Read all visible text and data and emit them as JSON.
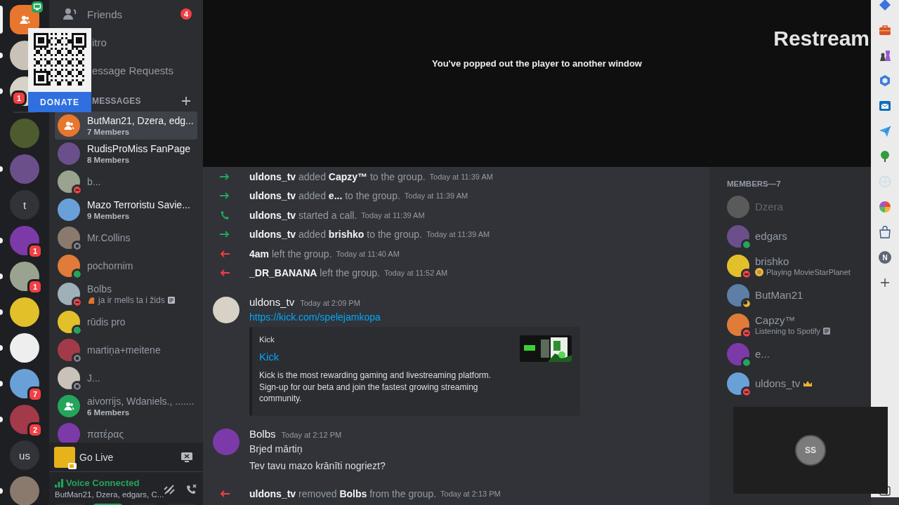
{
  "servers": [
    {
      "kind": "home",
      "selected": true
    },
    {
      "kind": "covered_avatar",
      "selected": false,
      "unread": true
    },
    {
      "kind": "covered_avatar",
      "selected": false,
      "unread": true,
      "badge": "1"
    },
    {
      "kind": "divider"
    },
    {
      "kind": "avatar",
      "selected": false,
      "unread": false
    },
    {
      "kind": "avatar",
      "selected": false,
      "unread": true
    },
    {
      "kind": "text",
      "label": "t",
      "selected": false,
      "unread": false
    },
    {
      "kind": "avatar",
      "selected": false,
      "unread": true,
      "badge": "1"
    },
    {
      "kind": "avatar",
      "selected": false,
      "unread": true,
      "badge": "1"
    },
    {
      "kind": "avatar",
      "selected": false,
      "unread": true
    },
    {
      "kind": "avatar",
      "selected": false,
      "unread": true
    },
    {
      "kind": "avatar",
      "selected": false,
      "unread": true,
      "badge": "7"
    },
    {
      "kind": "avatar",
      "selected": false,
      "unread": true,
      "badge": "2"
    },
    {
      "kind": "text",
      "label": "us",
      "selected": false,
      "unread": false
    },
    {
      "kind": "avatar",
      "selected": false,
      "unread": true
    }
  ],
  "donate": {
    "label": "DONATE"
  },
  "dm_nav": [
    {
      "kind": "friends",
      "label": "Friends",
      "badge": "4"
    },
    {
      "kind": "covered",
      "label": "itro"
    },
    {
      "kind": "covered",
      "label": "essage Requests"
    }
  ],
  "dm_header": {
    "label": "MESSAGES"
  },
  "dms": [
    {
      "kind": "group",
      "name": "ButMan21, Dzera, edg...",
      "subtitle": "7 Members",
      "color": "#e8762d",
      "selected": true,
      "unread": true
    },
    {
      "kind": "user",
      "name": "RudisProMiss FanPage",
      "subtitle": "8 Members",
      "selected": false,
      "unread": true
    },
    {
      "kind": "user",
      "name": "b...",
      "status": {
        "kind": "dnd"
      },
      "selected": false,
      "unread": false
    },
    {
      "kind": "user",
      "name": "Mazo Terroristu Savie...",
      "subtitle": "9 Members",
      "selected": false,
      "unread": true
    },
    {
      "kind": "user",
      "name": "Mr.Collins",
      "status": {
        "kind": "offline"
      },
      "selected": false,
      "unread": false
    },
    {
      "kind": "user",
      "name": "pochornim",
      "status": {
        "kind": "online"
      },
      "selected": false,
      "unread": false
    },
    {
      "kind": "user",
      "name": "Bolbs",
      "status": {
        "kind": "dnd"
      },
      "activity": "ja ir mells ta i žids",
      "selected": false,
      "unread": false
    },
    {
      "kind": "user",
      "name": "rūdis pro",
      "status": {
        "kind": "online"
      },
      "selected": false,
      "unread": false
    },
    {
      "kind": "user",
      "name": "martiņa+meitene",
      "status": {
        "kind": "offline"
      },
      "selected": false,
      "unread": false
    },
    {
      "kind": "user",
      "name": "J...",
      "status": {
        "kind": "offline"
      },
      "selected": false,
      "unread": false
    },
    {
      "kind": "group",
      "name": "aivorrijs, Wdaniels., .......",
      "subtitle": "6 Members",
      "color": "#23a55a",
      "selected": false,
      "unread": false
    },
    {
      "kind": "user",
      "name": "πατέρας",
      "selected": false,
      "unread": false
    }
  ],
  "go_live": {
    "label": "Go Live"
  },
  "voice": {
    "status": "Voice Connected",
    "channel": "ButMan21, Dzera, edgars, C...",
    "buttons": [
      {
        "on": false
      },
      {
        "on": true
      },
      {
        "on": false
      },
      {
        "on": false
      }
    ]
  },
  "stream": {
    "message": "You've popped out the player to another window",
    "logo": "Restream"
  },
  "chat": {
    "items": [
      {
        "kind": "join",
        "text": "**uldons_tv** added **Capzy™** to the group.",
        "time": "Today at 11:39 AM"
      },
      {
        "kind": "join",
        "text": "**uldons_tv** added **e...** to the group.",
        "time": "Today at 11:39 AM"
      },
      {
        "kind": "call",
        "text": "**uldons_tv** started a call.",
        "time": "Today at 11:39 AM"
      },
      {
        "kind": "join",
        "text": "**uldons_tv** added **brishko** to the group.",
        "time": "Today at 11:39 AM"
      },
      {
        "kind": "leave",
        "text": "**4am** left the group.",
        "time": "Today at 11:40 AM"
      },
      {
        "kind": "leave",
        "text": "**_DR_BANANA** left the group.",
        "time": "Today at 11:52 AM"
      },
      {
        "kind": "message",
        "author": "uldons_tv",
        "time": "Today at 2:09 PM",
        "link": "https://kick.com/spelejamkopa",
        "embed": {
          "provider": "Kick",
          "title": "Kick",
          "description": "Kick is the most rewarding gaming and livestreaming platform. Sign-up for our beta and join the fastest growing streaming community."
        }
      },
      {
        "kind": "message",
        "author": "Bolbs",
        "time": "Today at 2:12 PM",
        "lines": [
          "Brjed mārtiņ",
          "Tev tavu mazo krānīti nogriezt?"
        ]
      },
      {
        "kind": "leave",
        "text": "**uldons_tv** removed **Bolbs** from the group.",
        "time": "Today at 2:13 PM"
      }
    ]
  },
  "members": {
    "header": "MEMBERS—7",
    "items": [
      {
        "name": "Dzera",
        "status": {
          "kind": "offline"
        }
      },
      {
        "name": "edgars",
        "status": {
          "kind": "online"
        }
      },
      {
        "name": "brishko",
        "status": {
          "kind": "dnd"
        },
        "activity": {
          "kind": "playing",
          "text": "Playing MovieStarPlanet"
        }
      },
      {
        "name": "ButMan21",
        "status": {
          "kind": "idle"
        }
      },
      {
        "name": "Capzy™",
        "status": {
          "kind": "dnd"
        },
        "activity": {
          "kind": "listening",
          "text": "Listening to Spotify"
        }
      },
      {
        "name": "e...",
        "status": {
          "kind": "online"
        }
      },
      {
        "name": "uldons_tv",
        "status": {
          "kind": "dnd"
        },
        "owner": true
      }
    ]
  },
  "browser_bar": [
    {
      "kind": "diamond"
    },
    {
      "kind": "briefcase"
    },
    {
      "kind": "chess"
    },
    {
      "kind": "hexagon"
    },
    {
      "kind": "mail"
    },
    {
      "kind": "send"
    },
    {
      "kind": "tree"
    },
    {
      "kind": "compass"
    },
    {
      "kind": "ring"
    },
    {
      "kind": "bag"
    },
    {
      "kind": "letter",
      "label": "N"
    },
    {
      "kind": "plus"
    },
    {
      "kind": "panel"
    }
  ],
  "mini_player": {
    "initials": "SS"
  }
}
